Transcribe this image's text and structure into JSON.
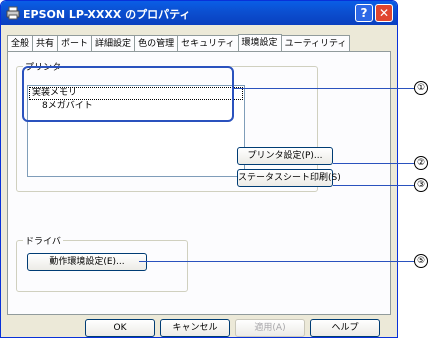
{
  "window": {
    "title": "EPSON LP-XXXX のプロパティ",
    "help_label": "?",
    "close_label": "✕"
  },
  "tabs": [
    {
      "label": "全般"
    },
    {
      "label": "共有"
    },
    {
      "label": "ポート"
    },
    {
      "label": "詳細設定"
    },
    {
      "label": "色の管理"
    },
    {
      "label": "セキュリティ"
    },
    {
      "label": "環境設定"
    },
    {
      "label": "ユーティリティ"
    }
  ],
  "printer_group": {
    "label": "プリンタ",
    "items": [
      {
        "label": "実装メモリ"
      },
      {
        "label": "8メガバイト"
      }
    ],
    "printer_settings_button": "プリンタ設定(P)...",
    "status_sheet_button": "ステータスシート印刷(S)"
  },
  "driver_group": {
    "label": "ドライバ",
    "operation_settings_button": "動作環境設定(E)..."
  },
  "footer": {
    "ok": "OK",
    "cancel": "キャンセル",
    "apply": "適用(A)",
    "help": "ヘルプ"
  },
  "callouts": [
    "①",
    "②",
    "③",
    "⑤"
  ]
}
